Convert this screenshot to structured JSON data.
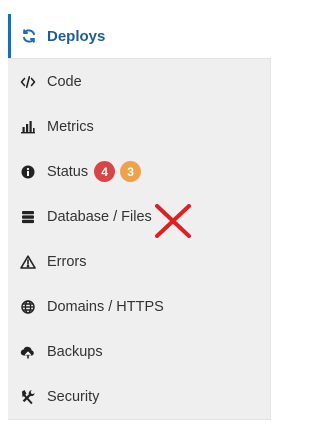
{
  "colors": {
    "accent": "#1e6bb8",
    "active_text": "#1f5d99",
    "badge_red": "#d94545",
    "badge_orange": "#f0a24a",
    "cross_red": "#e02020"
  },
  "sidebar": {
    "active": {
      "label": "Deploys",
      "icon": "refresh-icon"
    },
    "items": [
      {
        "label": "Code",
        "icon": "code-icon"
      },
      {
        "label": "Metrics",
        "icon": "bar-chart-icon"
      },
      {
        "label": "Status",
        "icon": "info-icon",
        "badges": [
          "4",
          "3"
        ]
      },
      {
        "label": "Database / Files",
        "icon": "database-icon"
      },
      {
        "label": "Errors",
        "icon": "warning-icon"
      },
      {
        "label": "Domains / HTTPS",
        "icon": "globe-icon"
      },
      {
        "label": "Backups",
        "icon": "cloud-upload-icon"
      },
      {
        "label": "Security",
        "icon": "tools-icon"
      }
    ]
  }
}
